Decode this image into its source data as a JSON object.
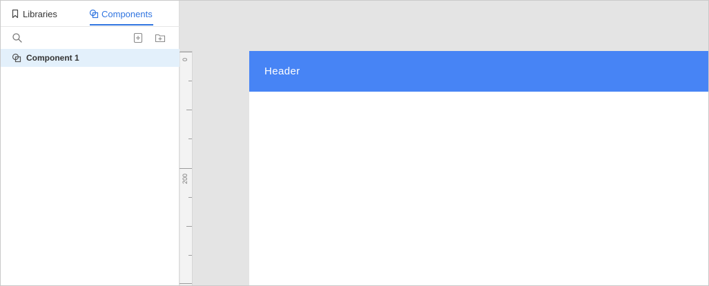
{
  "sidebar": {
    "tabs": [
      {
        "label": "Libraries",
        "icon": "bookmark-icon",
        "active": false
      },
      {
        "label": "Components",
        "icon": "components-icon",
        "active": true
      }
    ],
    "toolbar": {
      "icons": [
        "search-icon",
        "add-component-icon",
        "add-folder-icon"
      ]
    },
    "items": [
      {
        "label": "Component 1",
        "icon": "component-icon",
        "selected": true
      }
    ]
  },
  "ruler": {
    "labels": [
      "0",
      "200"
    ]
  },
  "canvas": {
    "header_text": "Header"
  },
  "colors": {
    "accent": "#2f74e0",
    "header_bg": "#4784f5",
    "selected_row": "#e3f0fb",
    "canvas_bg": "#e4e4e4"
  }
}
